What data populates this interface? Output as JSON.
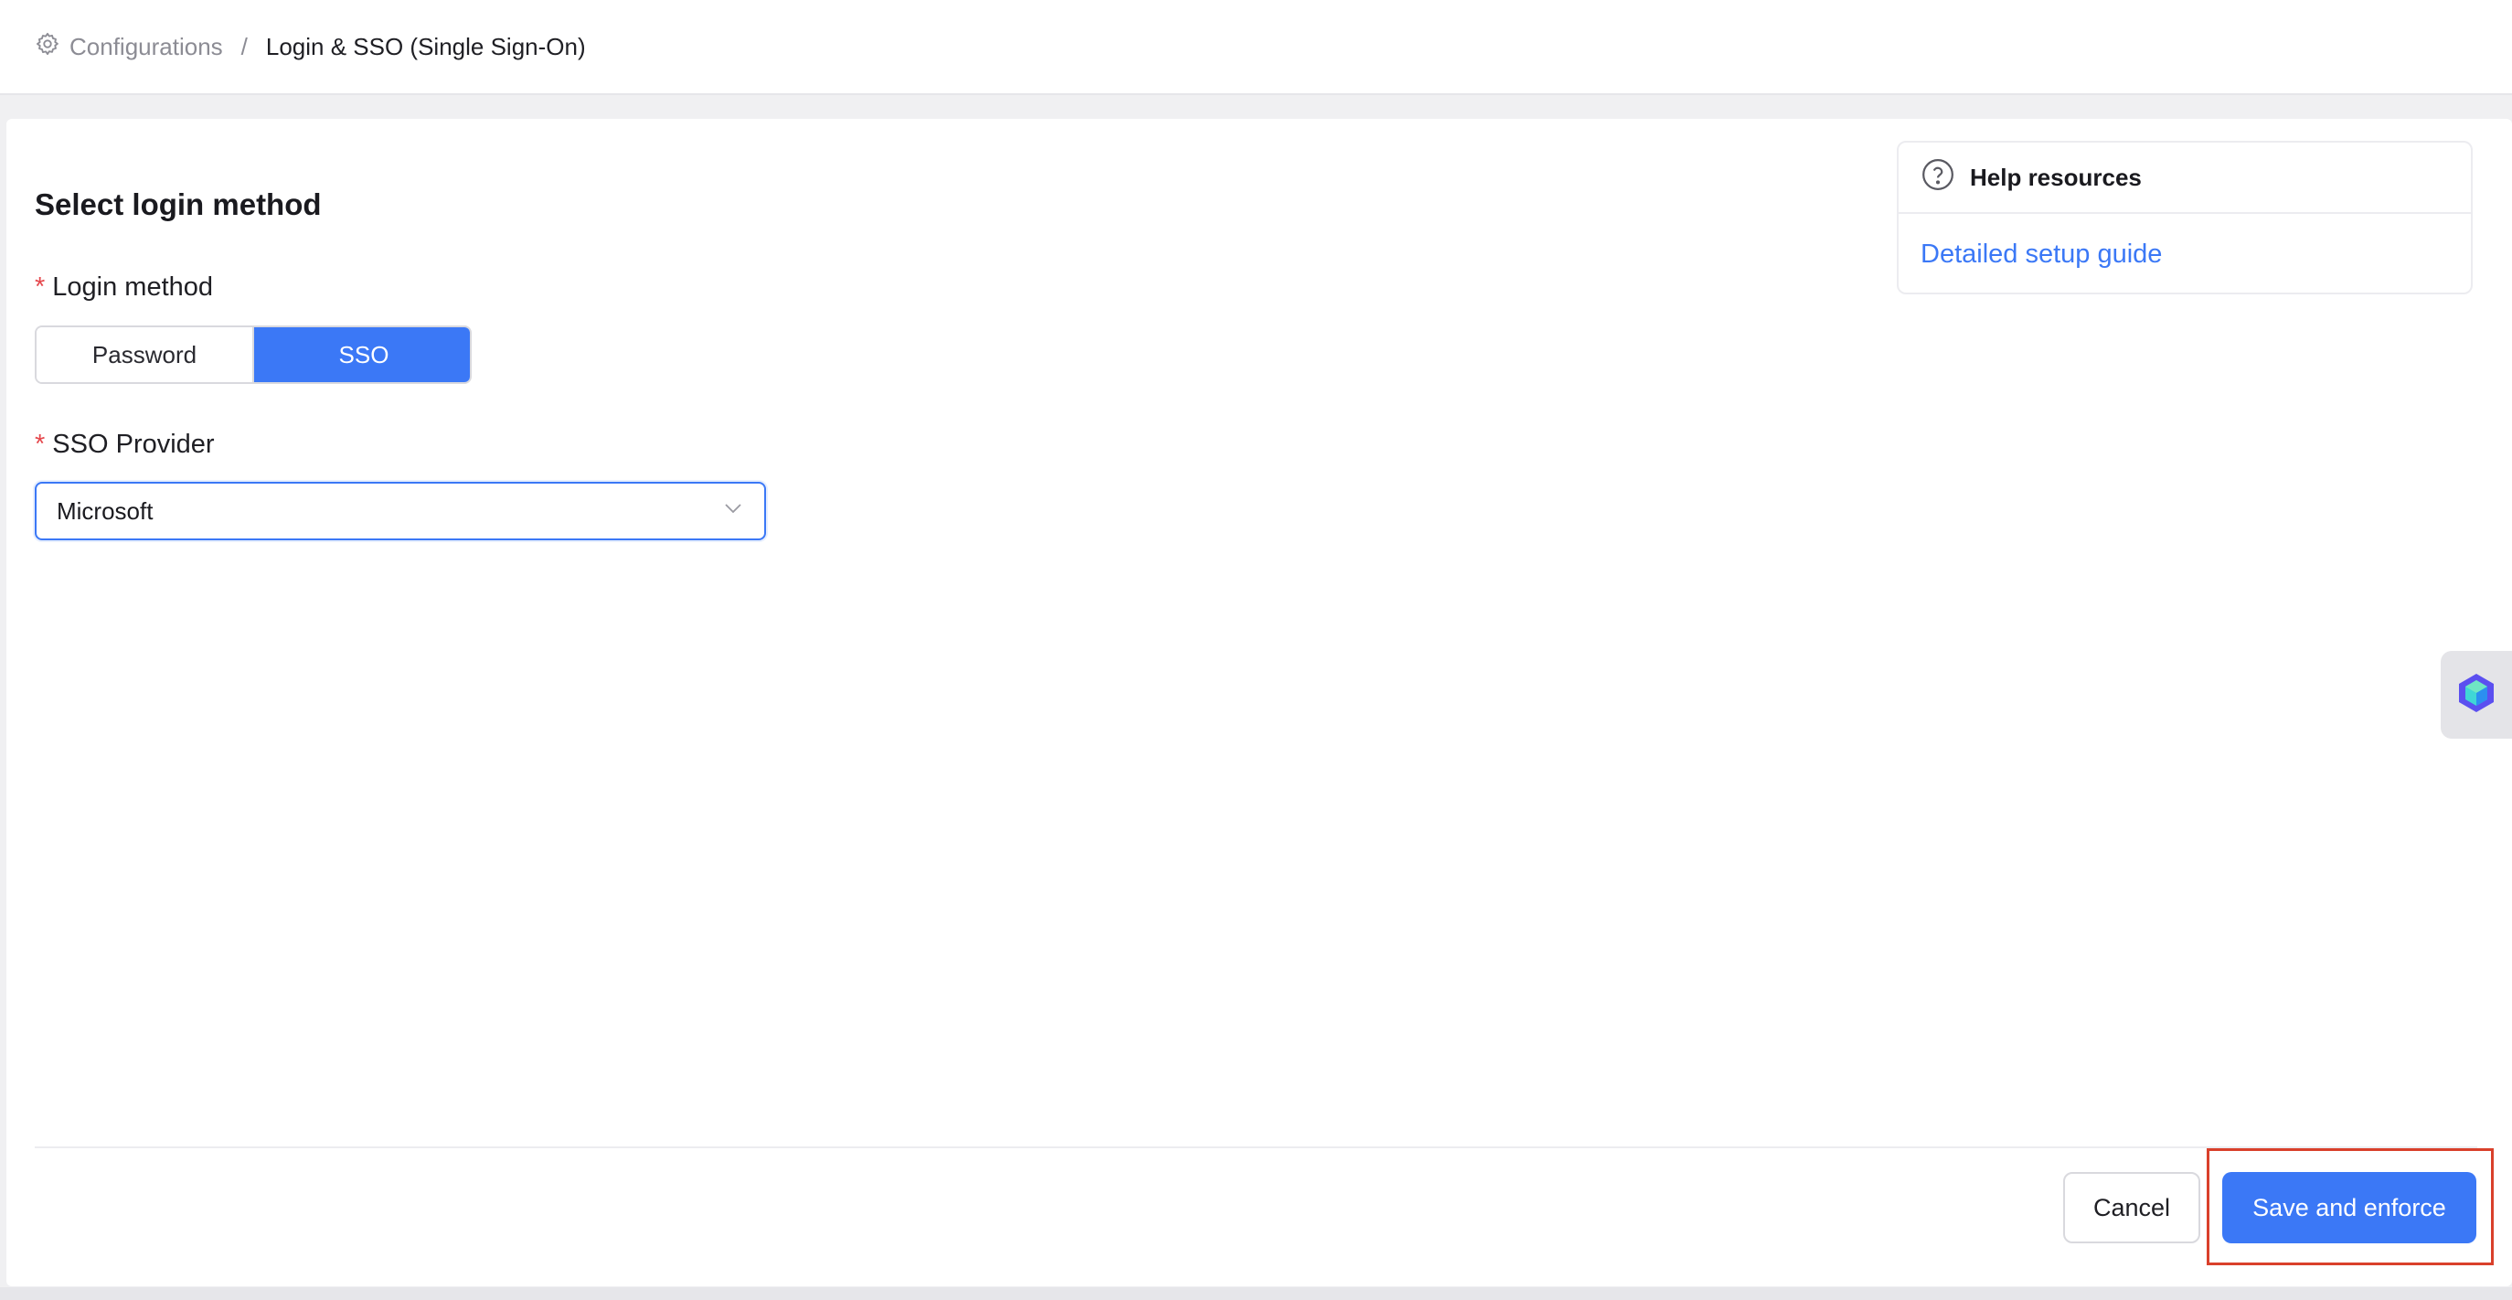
{
  "breadcrumb": {
    "root_label": "Configurations",
    "separator": "/",
    "current_label": "Login & SSO (Single Sign-On)"
  },
  "form": {
    "title": "Select login method",
    "login_method": {
      "label": "Login method",
      "required_mark": "*",
      "options": [
        "Password",
        "SSO"
      ],
      "selected": "SSO"
    },
    "sso_provider": {
      "label": "SSO Provider",
      "required_mark": "*",
      "value": "Microsoft"
    }
  },
  "help": {
    "title": "Help resources",
    "link_label": "Detailed setup guide"
  },
  "footer": {
    "cancel_label": "Cancel",
    "save_label": "Save and enforce"
  },
  "colors": {
    "accent": "#3b78f6",
    "required": "#e5484d",
    "highlight": "#d9402b"
  },
  "icons": {
    "breadcrumb": "gear-icon",
    "help": "question-circle-icon",
    "select": "chevron-down-icon",
    "side_widget": "assistant-cube-icon"
  }
}
